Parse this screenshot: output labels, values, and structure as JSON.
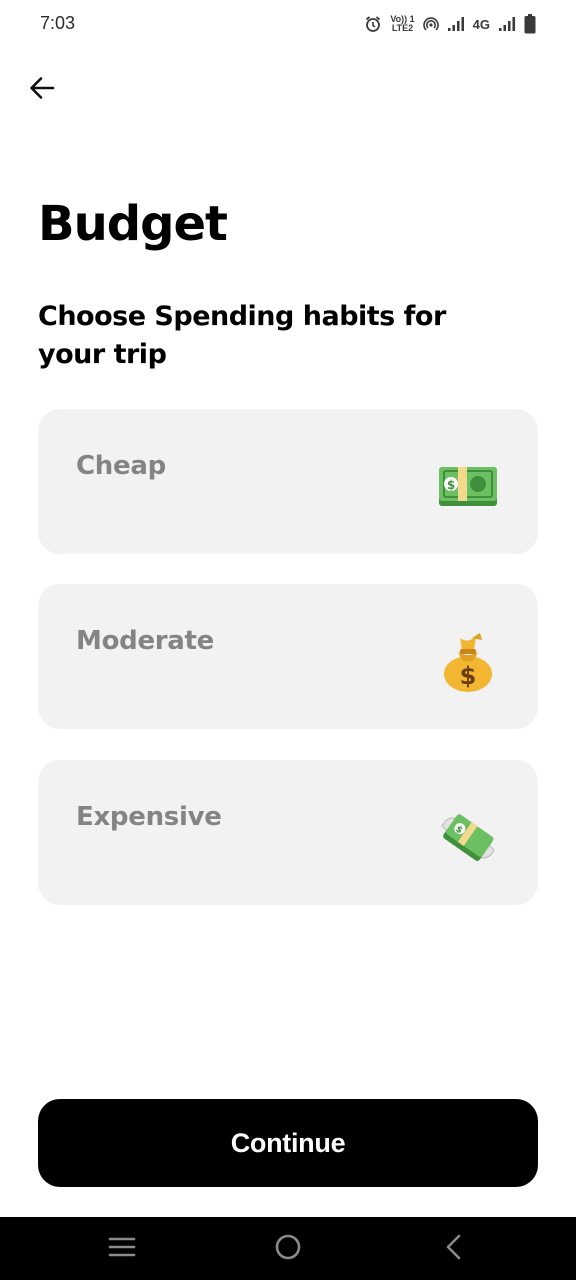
{
  "status_bar": {
    "time": "7:03",
    "volte_top": "Vo)) 1",
    "volte_bottom": "LTE2",
    "network": "4G",
    "icons": [
      "alarm-icon",
      "volte-icon",
      "hotspot-icon",
      "signal-icon",
      "signal-icon",
      "battery-icon"
    ]
  },
  "header": {
    "back_icon": "arrow-left-icon"
  },
  "page": {
    "title": "Budget",
    "subtitle": "Choose Spending habits for your trip"
  },
  "options": [
    {
      "label": "Cheap",
      "icon": "dollar-banknote-icon"
    },
    {
      "label": "Moderate",
      "icon": "money-bag-icon"
    },
    {
      "label": "Expensive",
      "icon": "money-with-wings-icon"
    }
  ],
  "continue_label": "Continue",
  "nav_bar": {
    "icons": [
      "menu-icon",
      "home-circle-icon",
      "back-chevron-icon"
    ]
  },
  "colors": {
    "background": "#ffffff",
    "card_background": "#f2f2f2",
    "option_text": "#848484",
    "primary_button": "#000000",
    "primary_button_text": "#ffffff",
    "money_green": "#5fb05a",
    "money_bag_gold": "#f2b632"
  }
}
